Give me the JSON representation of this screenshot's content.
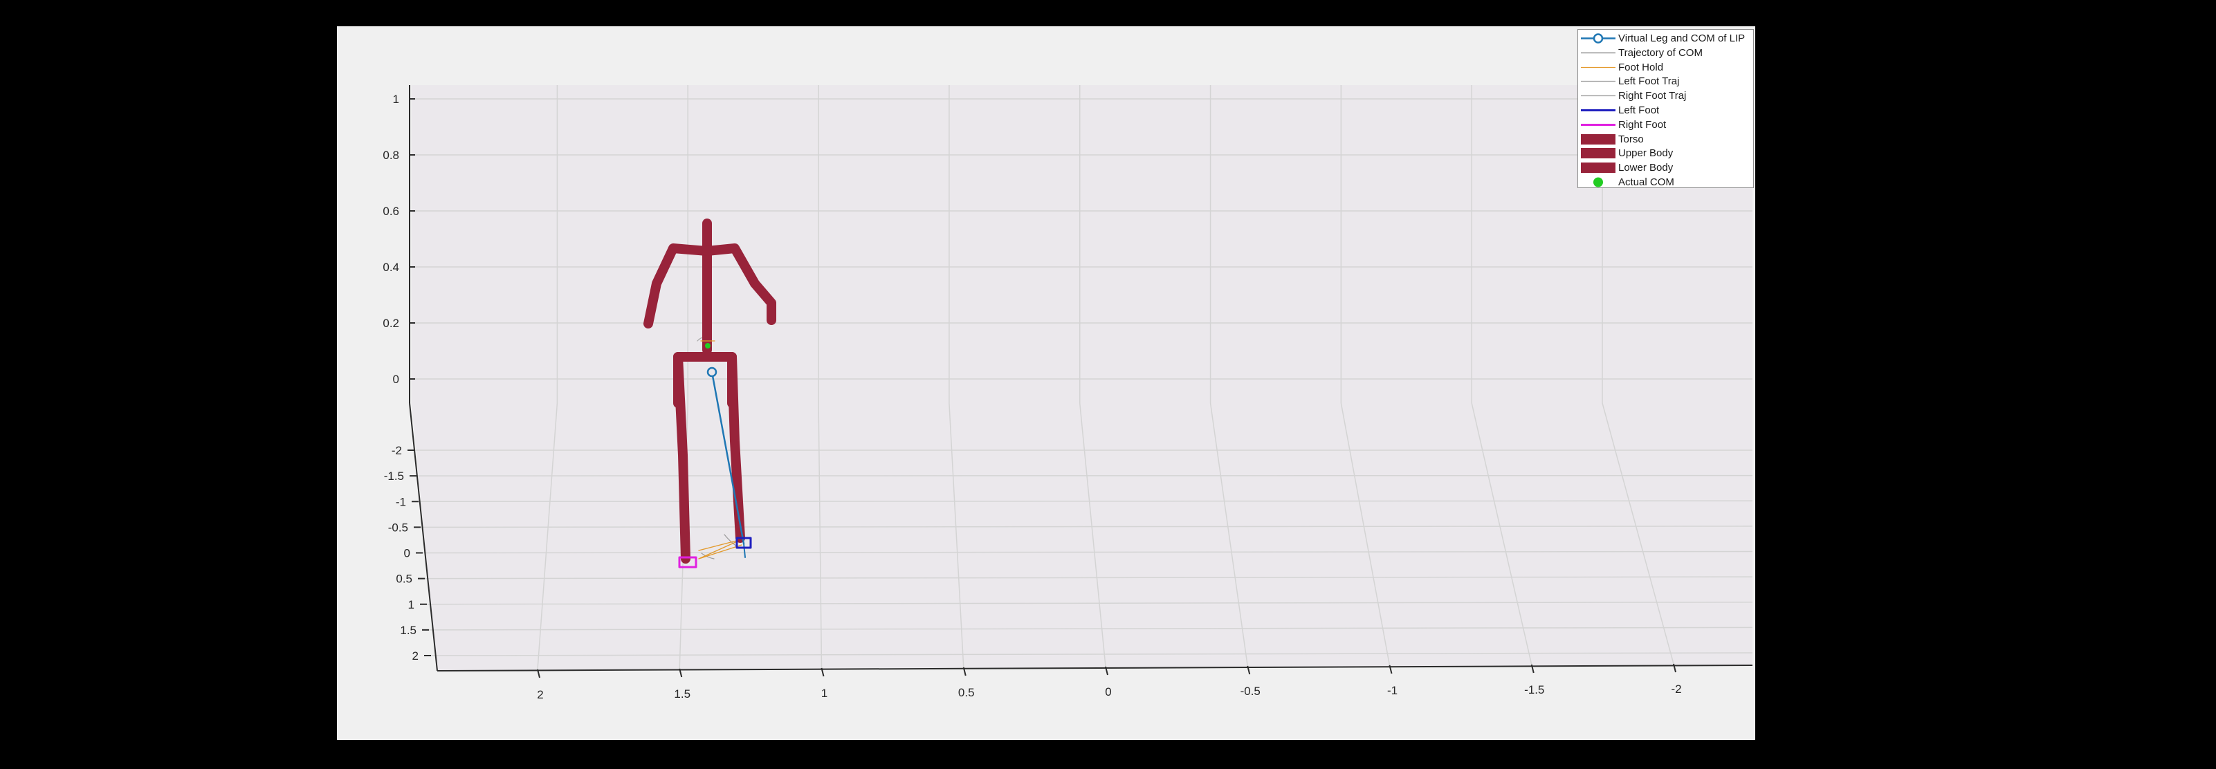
{
  "figure": {
    "colors": {
      "background": "#000000",
      "figure_bg": "#f0f0f0",
      "axes_bg": "#ebe8ec",
      "grid": "#d4d4d4",
      "body": "#98233a",
      "virtual_leg": "#1f77b4",
      "left_foot": "#1f1fbf",
      "right_foot": "#e020e0",
      "foot_hold": "#e39a2b",
      "actual_com": "#22cc22"
    }
  },
  "axes": {
    "z_ticks": [
      "1",
      "0.8",
      "0.6",
      "0.4",
      "0.2",
      "0"
    ],
    "y_ticks": [
      "-2",
      "-1.5",
      "-1",
      "-0.5",
      "0",
      "0.5",
      "1",
      "1.5",
      "2"
    ],
    "x_ticks": [
      "2",
      "1.5",
      "1",
      "0.5",
      "0",
      "-0.5",
      "-1",
      "-1.5",
      "-2"
    ]
  },
  "legend": {
    "items": [
      {
        "label": "Virtual Leg and COM of LIP",
        "icon": "line-circle-marker",
        "color": "#1f77b4"
      },
      {
        "label": "Trajectory of COM",
        "icon": "thin-line",
        "color": "#7a7a7a"
      },
      {
        "label": "Foot Hold",
        "icon": "thin-line",
        "color": "#e39a2b"
      },
      {
        "label": "Left Foot Traj",
        "icon": "thin-line",
        "color": "#9a9a9a"
      },
      {
        "label": "Right Foot Traj",
        "icon": "thin-line",
        "color": "#9a9a9a"
      },
      {
        "label": "Left Foot",
        "icon": "line",
        "color": "#1f1fbf"
      },
      {
        "label": "Right Foot",
        "icon": "line",
        "color": "#e020e0"
      },
      {
        "label": "Torso",
        "icon": "thick-bar",
        "color": "#98233a"
      },
      {
        "label": "Upper Body",
        "icon": "thick-bar",
        "color": "#98233a"
      },
      {
        "label": "Lower Body",
        "icon": "thick-bar",
        "color": "#98233a"
      },
      {
        "label": "Actual COM",
        "icon": "filled-dot",
        "color": "#22cc22"
      }
    ]
  }
}
